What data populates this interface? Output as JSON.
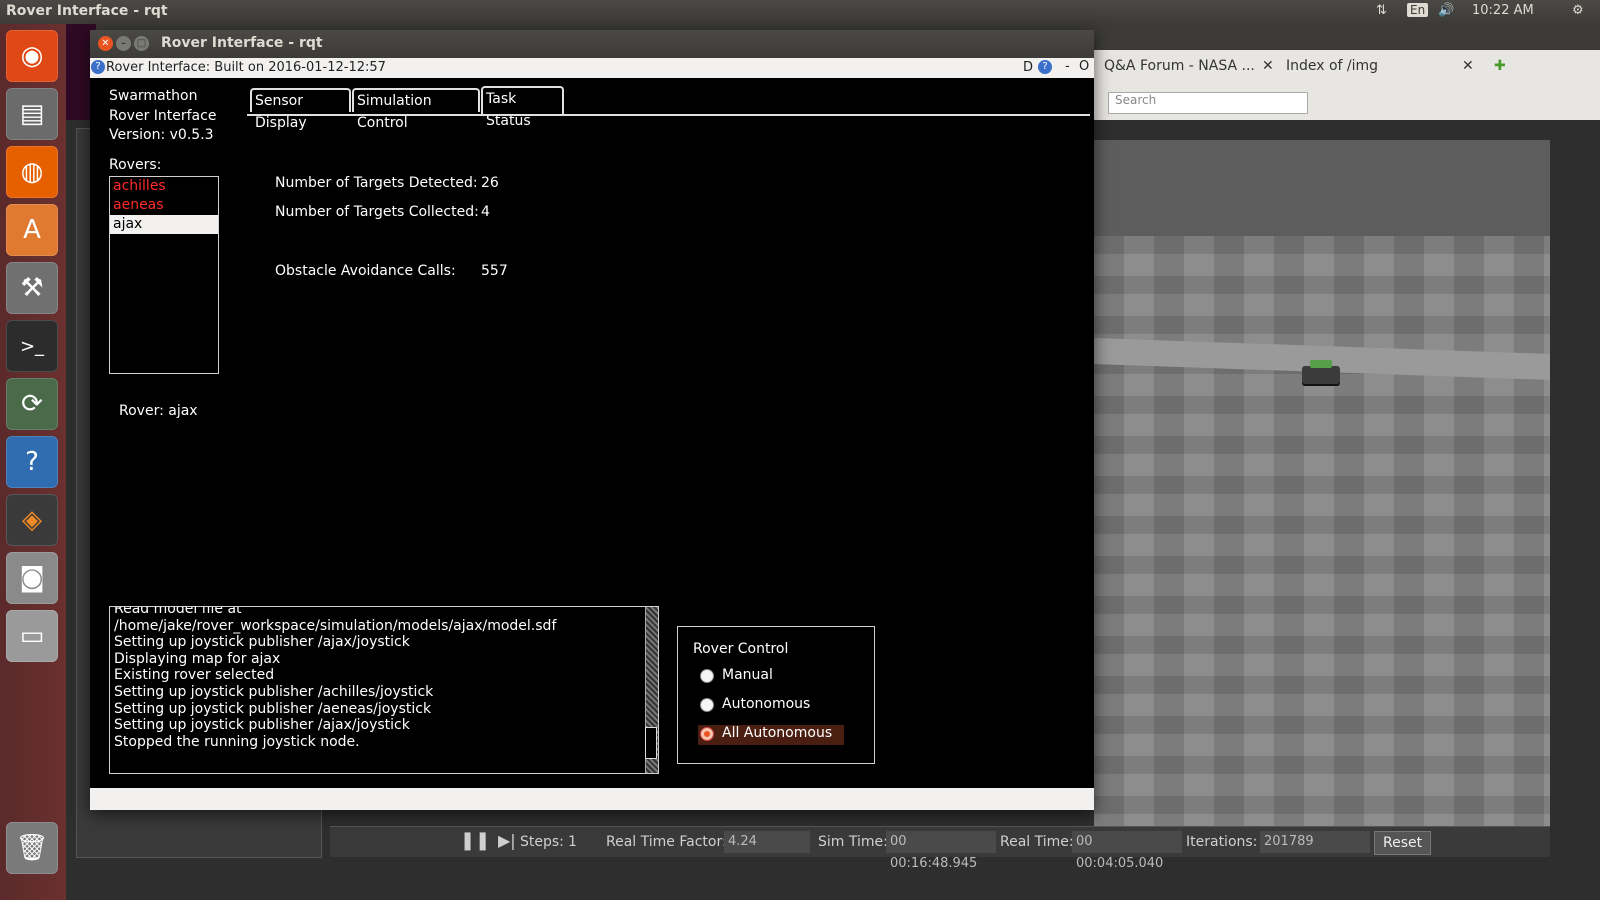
{
  "topbar": {
    "window_title": "Rover Interface - rqt",
    "keyboard": "En",
    "clock": "10:22 AM"
  },
  "launcher": {
    "items": [
      "ubuntu-dash-icon",
      "files-icon",
      "firefox-icon",
      "software-center-icon",
      "settings-icon",
      "terminal-icon",
      "updater-icon",
      "help-icon",
      "sublime-icon",
      "camera-icon",
      "disk-icon",
      "trash-icon"
    ]
  },
  "browser": {
    "tabs": [
      {
        "label": "Q&A Forum - NASA ..."
      },
      {
        "label": "Index of /img"
      }
    ],
    "search_placeholder": "Search"
  },
  "rqt": {
    "title": "Rover Interface - rqt",
    "subtitle": "Rover Interface: Built on 2016-01-12-12:57",
    "sub_controls": "D",
    "app_name_line1": "Swarmathon",
    "app_name_line2": "Rover Interface",
    "version": "Version:  v0.5.3",
    "rovers_label": "Rovers:",
    "rovers": [
      {
        "name": "achilles",
        "status": "red"
      },
      {
        "name": "aeneas",
        "status": "red"
      },
      {
        "name": "ajax",
        "status": "selected"
      }
    ],
    "current_rover": "Rover: ajax",
    "tabs": [
      {
        "label": "Sensor Display"
      },
      {
        "label": "Simulation Control"
      },
      {
        "label": "Task Status"
      }
    ],
    "active_tab": "Task Status",
    "stats": {
      "targets_detected_label": "Number of Targets Detected:",
      "targets_detected_value": "26",
      "targets_collected_label": "Number of Targets Collected:",
      "targets_collected_value": "4",
      "obstacle_calls_label": "Obstacle Avoidance Calls:",
      "obstacle_calls_value": "557"
    },
    "log_lines": [
      "Read model file at",
      "/home/jake/rover_workspace/simulation/models/ajax/model.sdf",
      "Setting up joystick publisher /ajax/joystick",
      "Displaying map for ajax",
      "Existing rover selected",
      "Setting up joystick publisher /achilles/joystick",
      "Setting up joystick publisher /aeneas/joystick",
      "Setting up joystick publisher /ajax/joystick",
      "Stopped the running joystick node."
    ],
    "control": {
      "title": "Rover Control",
      "options": [
        {
          "label": "Manual",
          "checked": false
        },
        {
          "label": "Autonomous",
          "checked": false
        },
        {
          "label": "All Autonomous",
          "checked": true
        }
      ]
    }
  },
  "gazebo": {
    "steps_label": "Steps:",
    "steps_value": "1",
    "rtf_label": "Real Time Factor:",
    "rtf_value": "4.24",
    "sim_time_label": "Sim Time:",
    "sim_time_value": "00 00:16:48.945",
    "real_time_label": "Real Time:",
    "real_time_value": "00 00:04:05.040",
    "iterations_label": "Iterations:",
    "iterations_value": "201789",
    "reset_label": "Reset"
  },
  "colors": {
    "launcher": "#5b2a2a",
    "accent": "#e95420",
    "rover_offline": "#ff2a2a"
  }
}
